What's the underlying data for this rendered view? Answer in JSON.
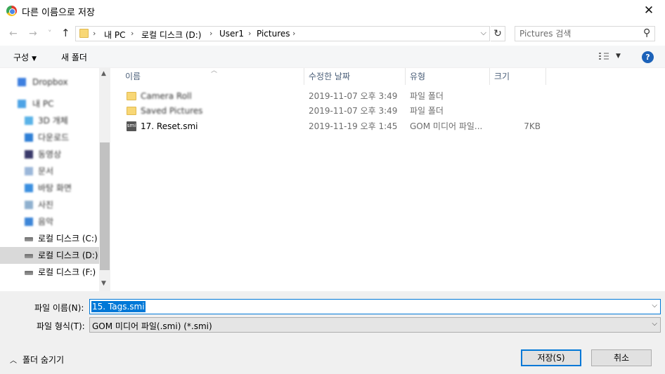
{
  "window": {
    "title": "다른 이름으로 저장",
    "close_glyph": "✕"
  },
  "nav": {
    "back": "←",
    "forward": "→",
    "recent": "˅",
    "up": "↑",
    "refresh": "↻",
    "dropdown": "⌵"
  },
  "address": {
    "crumbs": [
      "내 PC",
      "로컬 디스크 (D:)",
      "User1",
      "Pictures"
    ],
    "separator": "›"
  },
  "search": {
    "placeholder": "Pictures 검색",
    "icon": "⚲"
  },
  "toolbar": {
    "organize": "구성",
    "organize_arrow": "▼",
    "new_folder": "새 폴더",
    "view_arrow": "▼",
    "help": "?"
  },
  "sidebar": {
    "items": [
      {
        "label": "Dropbox",
        "blurred": true
      },
      {
        "label": "내 PC",
        "blurred": true
      },
      {
        "label": "3D 개체",
        "blurred": true
      },
      {
        "label": "다운로드",
        "blurred": true
      },
      {
        "label": "동영상",
        "blurred": true
      },
      {
        "label": "문서",
        "blurred": true
      },
      {
        "label": "바탕 화면",
        "blurred": true
      },
      {
        "label": "사진",
        "blurred": true
      },
      {
        "label": "음악",
        "blurred": true
      },
      {
        "label": "로컬 디스크 (C:)",
        "blurred": false
      },
      {
        "label": "로컬 디스크 (D:)",
        "blurred": false
      },
      {
        "label": "로컬 디스크 (F:)",
        "blurred": false
      }
    ],
    "scroll_up": "▲",
    "scroll_down": "▼"
  },
  "columns": {
    "name": "이름",
    "modified": "수정한 날짜",
    "type": "유형",
    "size": "크기",
    "sort_arrow": "︿"
  },
  "files": [
    {
      "name": "Camera Roll",
      "modified": "2019-11-07 오후 3:49",
      "type": "파일 폴더",
      "size": "",
      "icon": "folder-icon",
      "blurred": true
    },
    {
      "name": "Saved Pictures",
      "modified": "2019-11-07 오후 3:49",
      "type": "파일 폴더",
      "size": "",
      "icon": "folder-icon",
      "blurred": true
    },
    {
      "name": "17. Reset.smi",
      "modified": "2019-11-19 오후 1:45",
      "type": "GOM 미디어 파일...",
      "size": "7KB",
      "icon": "smi-file-icon",
      "icon_text": "smi",
      "blurred": false
    }
  ],
  "form": {
    "filename_label": "파일 이름(N):",
    "filename_value": "15. Tags.smi",
    "filetype_label": "파일 형식(T):",
    "filetype_value": "GOM 미디어 파일(.smi) (*.smi)",
    "dropdown_glyph": "⌵"
  },
  "footer": {
    "hide_folders": "폴더 숨기기",
    "hide_chevron": "︿",
    "save": "저장(S)",
    "cancel": "취소"
  },
  "colors": {
    "accent": "#0078d7",
    "selection": "#cce8ff",
    "header_text": "#4c607a",
    "help_blue": "#1c62b9"
  }
}
